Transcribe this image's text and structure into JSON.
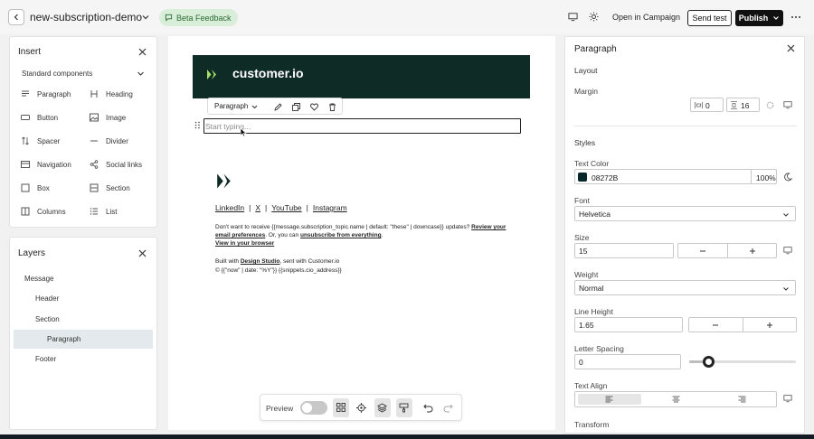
{
  "topbar": {
    "title": "new-subscription-demo",
    "beta_label": "Beta Feedback",
    "open_campaign": "Open in Campaign",
    "send_test": "Send test",
    "publish": "Publish"
  },
  "insert": {
    "title": "Insert",
    "group_title": "Standard components",
    "items": [
      {
        "label": "Paragraph",
        "icon": "paragraph-icon"
      },
      {
        "label": "Heading",
        "icon": "heading-icon"
      },
      {
        "label": "Button",
        "icon": "button-icon"
      },
      {
        "label": "Image",
        "icon": "image-icon"
      },
      {
        "label": "Spacer",
        "icon": "spacer-icon"
      },
      {
        "label": "Divider",
        "icon": "divider-icon"
      },
      {
        "label": "Navigation",
        "icon": "navigation-icon"
      },
      {
        "label": "Social links",
        "icon": "social-links-icon"
      },
      {
        "label": "Box",
        "icon": "box-icon"
      },
      {
        "label": "Section",
        "icon": "section-icon"
      },
      {
        "label": "Columns",
        "icon": "columns-icon"
      },
      {
        "label": "List",
        "icon": "list-icon"
      }
    ]
  },
  "layers": {
    "title": "Layers",
    "items": [
      "Message",
      "Header",
      "Section",
      "Paragraph",
      "Footer"
    ]
  },
  "canvas": {
    "logo_text": "customer.io",
    "toolbar_select": "Paragraph",
    "text_placeholder": "Start typing...",
    "links": [
      "LinkedIn",
      "X",
      "YouTube",
      "Instagram"
    ],
    "link_separator": "|",
    "body_line1_pre": "Don't want to receive {{message.subscription_topic.name | default: \"these\" | downcase}} updates?",
    "body_line1_link": "Review your email preferences",
    "body_line2_pre": ". Or, you can",
    "body_line2_link": "unsubscribe from everything",
    "body_line2_post": ".",
    "view_in_browser": "View in your browser",
    "built_with_pre": "Built with",
    "built_with_link": "Design Studio",
    "built_with_post": ", sent with Customer.io",
    "copyright": "© {{\"now\" | date: \"%Y\"}} {{snippets.cio_address}}"
  },
  "preview_bar": {
    "label": "Preview",
    "toggle_on": false
  },
  "props": {
    "title": "Paragraph",
    "layout_label": "Layout",
    "margin_label": "Margin",
    "margin_x": "0",
    "margin_y": "16",
    "styles_label": "Styles",
    "text_color_label": "Text Color",
    "text_color_value": "08272B",
    "text_color_hex": "#08272B",
    "text_color_opacity": "100%",
    "font_label": "Font",
    "font_value": "Helvetica",
    "size_label": "Size",
    "size_value": "15",
    "weight_label": "Weight",
    "weight_value": "Normal",
    "line_height_label": "Line Height",
    "line_height_value": "1.65",
    "letter_spacing_label": "Letter Spacing",
    "letter_spacing_value": "0",
    "letter_spacing_slider_fraction": 0.18,
    "text_align_label": "Text Align",
    "text_align_selected": "left",
    "transform_label": "Transform"
  },
  "colors": {
    "email_header_bg": "#0f2b26",
    "beta_bg": "#d8eed8",
    "publish_bg": "#111111"
  }
}
